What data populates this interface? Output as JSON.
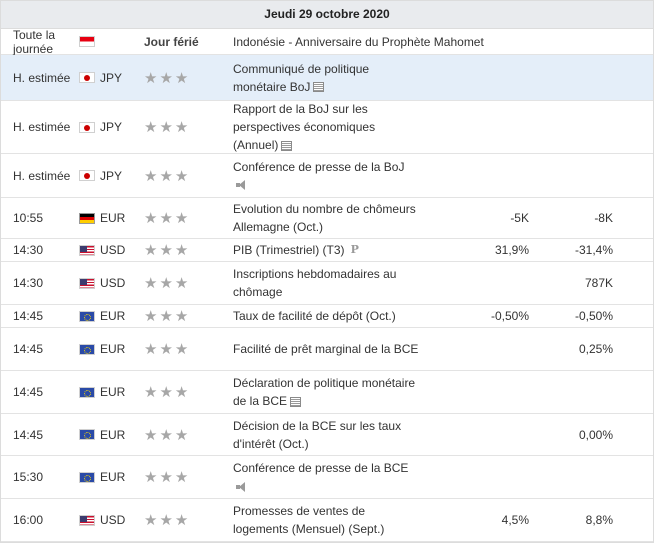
{
  "date_header": "Jeudi 29 octobre 2020",
  "holiday": {
    "time": "Toute la journée",
    "flag": "indonesia-flag",
    "label": "Jour férié",
    "text": "Indonésie - Anniversaire du Prophète Mahomet"
  },
  "events": [
    {
      "time": "H. estimée",
      "flag": "jp",
      "currency": "JPY",
      "stars": 3,
      "title": "Communiqué de politique monétaire BoJ",
      "icon": "document-icon",
      "actual": "",
      "forecast": "",
      "highlighted": true
    },
    {
      "time": "H. estimée",
      "flag": "jp",
      "currency": "JPY",
      "stars": 3,
      "title": "Rapport de la BoJ sur les perspectives économiques (Annuel)",
      "icon": "document-icon",
      "actual": "",
      "forecast": ""
    },
    {
      "time": "H. estimée",
      "flag": "jp",
      "currency": "JPY",
      "stars": 3,
      "title": "Conférence de presse de la BoJ",
      "icon": "speaker-icon",
      "actual": "",
      "forecast": ""
    },
    {
      "time": "10:55",
      "flag": "de",
      "currency": "EUR",
      "stars": 3,
      "title": "Evolution du nombre de chômeurs Allemagne (Oct.)",
      "icon": "",
      "actual": "-5K",
      "forecast": "-8K"
    },
    {
      "time": "14:30",
      "flag": "us",
      "currency": "USD",
      "stars": 3,
      "title": "PIB (Trimestriel) (T3)",
      "icon": "preliminary-icon",
      "actual": "31,9%",
      "forecast": "-31,4%"
    },
    {
      "time": "14:30",
      "flag": "us",
      "currency": "USD",
      "stars": 3,
      "title": "Inscriptions hebdomadaires au chômage",
      "icon": "",
      "actual": "",
      "forecast": "787K"
    },
    {
      "time": "14:45",
      "flag": "eu",
      "currency": "EUR",
      "stars": 3,
      "title": "Taux de facilité de dépôt (Oct.)",
      "icon": "",
      "actual": "-0,50%",
      "forecast": "-0,50%"
    },
    {
      "time": "14:45",
      "flag": "eu",
      "currency": "EUR",
      "stars": 3,
      "title": "Facilité de prêt marginal de la BCE",
      "icon": "",
      "actual": "",
      "forecast": "0,25%"
    },
    {
      "time": "14:45",
      "flag": "eu",
      "currency": "EUR",
      "stars": 3,
      "title": "Déclaration de politique monétaire de la BCE",
      "icon": "document-icon",
      "actual": "",
      "forecast": ""
    },
    {
      "time": "14:45",
      "flag": "eu",
      "currency": "EUR",
      "stars": 3,
      "title": "Décision de la BCE sur les taux d'intérêt (Oct.)",
      "icon": "",
      "actual": "",
      "forecast": "0,00%"
    },
    {
      "time": "15:30",
      "flag": "eu",
      "currency": "EUR",
      "stars": 3,
      "title": "Conférence de presse de la BCE",
      "icon": "speaker-icon",
      "actual": "",
      "forecast": ""
    },
    {
      "time": "16:00",
      "flag": "us",
      "currency": "USD",
      "stars": 3,
      "title": "Promesses de ventes de logements (Mensuel) (Sept.)",
      "icon": "",
      "actual": "4,5%",
      "forecast": "8,8%"
    }
  ]
}
